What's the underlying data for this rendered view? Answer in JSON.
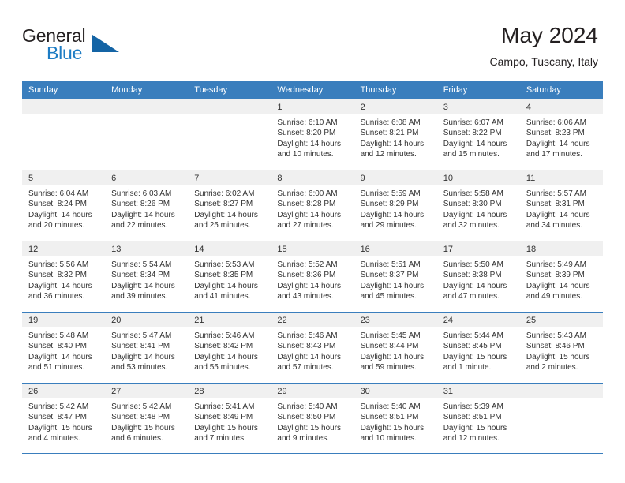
{
  "brand": {
    "name_top": "General",
    "name_bottom": "Blue",
    "accent_color": "#1464a5",
    "text_color": "#231f20"
  },
  "header": {
    "title": "May 2024",
    "location": "Campo, Tuscany, Italy"
  },
  "theme": {
    "header_row_bg": "#3a7ebd",
    "day_band_bg": "#f0f0f0",
    "grid_line": "#3a7ebd",
    "text": "#333333"
  },
  "weekday_headers": [
    "Sunday",
    "Monday",
    "Tuesday",
    "Wednesday",
    "Thursday",
    "Friday",
    "Saturday"
  ],
  "weeks": [
    [
      {
        "day": "",
        "sunrise": "",
        "sunset": "",
        "daylight_line1": "",
        "daylight_line2": ""
      },
      {
        "day": "",
        "sunrise": "",
        "sunset": "",
        "daylight_line1": "",
        "daylight_line2": ""
      },
      {
        "day": "",
        "sunrise": "",
        "sunset": "",
        "daylight_line1": "",
        "daylight_line2": ""
      },
      {
        "day": "1",
        "sunrise": "Sunrise: 6:10 AM",
        "sunset": "Sunset: 8:20 PM",
        "daylight_line1": "Daylight: 14 hours",
        "daylight_line2": "and 10 minutes."
      },
      {
        "day": "2",
        "sunrise": "Sunrise: 6:08 AM",
        "sunset": "Sunset: 8:21 PM",
        "daylight_line1": "Daylight: 14 hours",
        "daylight_line2": "and 12 minutes."
      },
      {
        "day": "3",
        "sunrise": "Sunrise: 6:07 AM",
        "sunset": "Sunset: 8:22 PM",
        "daylight_line1": "Daylight: 14 hours",
        "daylight_line2": "and 15 minutes."
      },
      {
        "day": "4",
        "sunrise": "Sunrise: 6:06 AM",
        "sunset": "Sunset: 8:23 PM",
        "daylight_line1": "Daylight: 14 hours",
        "daylight_line2": "and 17 minutes."
      }
    ],
    [
      {
        "day": "5",
        "sunrise": "Sunrise: 6:04 AM",
        "sunset": "Sunset: 8:24 PM",
        "daylight_line1": "Daylight: 14 hours",
        "daylight_line2": "and 20 minutes."
      },
      {
        "day": "6",
        "sunrise": "Sunrise: 6:03 AM",
        "sunset": "Sunset: 8:26 PM",
        "daylight_line1": "Daylight: 14 hours",
        "daylight_line2": "and 22 minutes."
      },
      {
        "day": "7",
        "sunrise": "Sunrise: 6:02 AM",
        "sunset": "Sunset: 8:27 PM",
        "daylight_line1": "Daylight: 14 hours",
        "daylight_line2": "and 25 minutes."
      },
      {
        "day": "8",
        "sunrise": "Sunrise: 6:00 AM",
        "sunset": "Sunset: 8:28 PM",
        "daylight_line1": "Daylight: 14 hours",
        "daylight_line2": "and 27 minutes."
      },
      {
        "day": "9",
        "sunrise": "Sunrise: 5:59 AM",
        "sunset": "Sunset: 8:29 PM",
        "daylight_line1": "Daylight: 14 hours",
        "daylight_line2": "and 29 minutes."
      },
      {
        "day": "10",
        "sunrise": "Sunrise: 5:58 AM",
        "sunset": "Sunset: 8:30 PM",
        "daylight_line1": "Daylight: 14 hours",
        "daylight_line2": "and 32 minutes."
      },
      {
        "day": "11",
        "sunrise": "Sunrise: 5:57 AM",
        "sunset": "Sunset: 8:31 PM",
        "daylight_line1": "Daylight: 14 hours",
        "daylight_line2": "and 34 minutes."
      }
    ],
    [
      {
        "day": "12",
        "sunrise": "Sunrise: 5:56 AM",
        "sunset": "Sunset: 8:32 PM",
        "daylight_line1": "Daylight: 14 hours",
        "daylight_line2": "and 36 minutes."
      },
      {
        "day": "13",
        "sunrise": "Sunrise: 5:54 AM",
        "sunset": "Sunset: 8:34 PM",
        "daylight_line1": "Daylight: 14 hours",
        "daylight_line2": "and 39 minutes."
      },
      {
        "day": "14",
        "sunrise": "Sunrise: 5:53 AM",
        "sunset": "Sunset: 8:35 PM",
        "daylight_line1": "Daylight: 14 hours",
        "daylight_line2": "and 41 minutes."
      },
      {
        "day": "15",
        "sunrise": "Sunrise: 5:52 AM",
        "sunset": "Sunset: 8:36 PM",
        "daylight_line1": "Daylight: 14 hours",
        "daylight_line2": "and 43 minutes."
      },
      {
        "day": "16",
        "sunrise": "Sunrise: 5:51 AM",
        "sunset": "Sunset: 8:37 PM",
        "daylight_line1": "Daylight: 14 hours",
        "daylight_line2": "and 45 minutes."
      },
      {
        "day": "17",
        "sunrise": "Sunrise: 5:50 AM",
        "sunset": "Sunset: 8:38 PM",
        "daylight_line1": "Daylight: 14 hours",
        "daylight_line2": "and 47 minutes."
      },
      {
        "day": "18",
        "sunrise": "Sunrise: 5:49 AM",
        "sunset": "Sunset: 8:39 PM",
        "daylight_line1": "Daylight: 14 hours",
        "daylight_line2": "and 49 minutes."
      }
    ],
    [
      {
        "day": "19",
        "sunrise": "Sunrise: 5:48 AM",
        "sunset": "Sunset: 8:40 PM",
        "daylight_line1": "Daylight: 14 hours",
        "daylight_line2": "and 51 minutes."
      },
      {
        "day": "20",
        "sunrise": "Sunrise: 5:47 AM",
        "sunset": "Sunset: 8:41 PM",
        "daylight_line1": "Daylight: 14 hours",
        "daylight_line2": "and 53 minutes."
      },
      {
        "day": "21",
        "sunrise": "Sunrise: 5:46 AM",
        "sunset": "Sunset: 8:42 PM",
        "daylight_line1": "Daylight: 14 hours",
        "daylight_line2": "and 55 minutes."
      },
      {
        "day": "22",
        "sunrise": "Sunrise: 5:46 AM",
        "sunset": "Sunset: 8:43 PM",
        "daylight_line1": "Daylight: 14 hours",
        "daylight_line2": "and 57 minutes."
      },
      {
        "day": "23",
        "sunrise": "Sunrise: 5:45 AM",
        "sunset": "Sunset: 8:44 PM",
        "daylight_line1": "Daylight: 14 hours",
        "daylight_line2": "and 59 minutes."
      },
      {
        "day": "24",
        "sunrise": "Sunrise: 5:44 AM",
        "sunset": "Sunset: 8:45 PM",
        "daylight_line1": "Daylight: 15 hours",
        "daylight_line2": "and 1 minute."
      },
      {
        "day": "25",
        "sunrise": "Sunrise: 5:43 AM",
        "sunset": "Sunset: 8:46 PM",
        "daylight_line1": "Daylight: 15 hours",
        "daylight_line2": "and 2 minutes."
      }
    ],
    [
      {
        "day": "26",
        "sunrise": "Sunrise: 5:42 AM",
        "sunset": "Sunset: 8:47 PM",
        "daylight_line1": "Daylight: 15 hours",
        "daylight_line2": "and 4 minutes."
      },
      {
        "day": "27",
        "sunrise": "Sunrise: 5:42 AM",
        "sunset": "Sunset: 8:48 PM",
        "daylight_line1": "Daylight: 15 hours",
        "daylight_line2": "and 6 minutes."
      },
      {
        "day": "28",
        "sunrise": "Sunrise: 5:41 AM",
        "sunset": "Sunset: 8:49 PM",
        "daylight_line1": "Daylight: 15 hours",
        "daylight_line2": "and 7 minutes."
      },
      {
        "day": "29",
        "sunrise": "Sunrise: 5:40 AM",
        "sunset": "Sunset: 8:50 PM",
        "daylight_line1": "Daylight: 15 hours",
        "daylight_line2": "and 9 minutes."
      },
      {
        "day": "30",
        "sunrise": "Sunrise: 5:40 AM",
        "sunset": "Sunset: 8:51 PM",
        "daylight_line1": "Daylight: 15 hours",
        "daylight_line2": "and 10 minutes."
      },
      {
        "day": "31",
        "sunrise": "Sunrise: 5:39 AM",
        "sunset": "Sunset: 8:51 PM",
        "daylight_line1": "Daylight: 15 hours",
        "daylight_line2": "and 12 minutes."
      },
      {
        "day": "",
        "sunrise": "",
        "sunset": "",
        "daylight_line1": "",
        "daylight_line2": ""
      }
    ]
  ]
}
